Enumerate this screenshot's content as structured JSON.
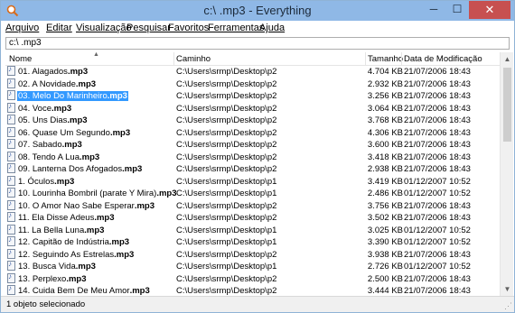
{
  "window": {
    "title": "c:\\ .mp3 - Everything",
    "min": "─",
    "max": "☐",
    "close": "✕"
  },
  "menu": [
    "Arquivo",
    "Editar",
    "Visualização",
    "Pesquisar",
    "Favoritos",
    "Ferramentas",
    "Ajuda"
  ],
  "search": {
    "value": "c:\\ .mp3"
  },
  "columns": {
    "name": "Nome",
    "path": "Caminho",
    "size": "Tamanho",
    "date": "Data de Modificação"
  },
  "rows": [
    {
      "name_pre": "01. Alagados",
      "name_ext": ".mp3",
      "path": "C:\\Users\\srmp\\Desktop\\p2",
      "size": "4.704 KB",
      "date": "21/07/2006 18:43"
    },
    {
      "name_pre": "02. A Novidade",
      "name_ext": ".mp3",
      "path": "C:\\Users\\srmp\\Desktop\\p2",
      "size": "2.932 KB",
      "date": "21/07/2006 18:43"
    },
    {
      "name_pre": "03. Melo Do Marinheiro",
      "name_ext": ".mp3",
      "path": "C:\\Users\\srmp\\Desktop\\p2",
      "size": "3.256 KB",
      "date": "21/07/2006 18:43",
      "selected": true
    },
    {
      "name_pre": "04. Voce",
      "name_ext": ".mp3",
      "path": "C:\\Users\\srmp\\Desktop\\p2",
      "size": "3.064 KB",
      "date": "21/07/2006 18:43"
    },
    {
      "name_pre": "05. Uns Dias",
      "name_ext": ".mp3",
      "path": "C:\\Users\\srmp\\Desktop\\p2",
      "size": "3.768 KB",
      "date": "21/07/2006 18:43"
    },
    {
      "name_pre": "06. Quase Um Segundo",
      "name_ext": ".mp3",
      "path": "C:\\Users\\srmp\\Desktop\\p2",
      "size": "4.306 KB",
      "date": "21/07/2006 18:43"
    },
    {
      "name_pre": "07. Sabado",
      "name_ext": ".mp3",
      "path": "C:\\Users\\srmp\\Desktop\\p2",
      "size": "3.600 KB",
      "date": "21/07/2006 18:43"
    },
    {
      "name_pre": "08. Tendo A Lua",
      "name_ext": ".mp3",
      "path": "C:\\Users\\srmp\\Desktop\\p2",
      "size": "3.418 KB",
      "date": "21/07/2006 18:43"
    },
    {
      "name_pre": "09. Lanterna Dos Afogados",
      "name_ext": ".mp3",
      "path": "C:\\Users\\srmp\\Desktop\\p2",
      "size": "2.938 KB",
      "date": "21/07/2006 18:43"
    },
    {
      "name_pre": "1. Óculos",
      "name_ext": ".mp3",
      "path": "C:\\Users\\srmp\\Desktop\\p1",
      "size": "3.419 KB",
      "date": "01/12/2007 10:52"
    },
    {
      "name_pre": "10. Lourinha Bombril (parate Y Mira)",
      "name_ext": ".mp3",
      "path": "C:\\Users\\srmp\\Desktop\\p1",
      "size": "2.486 KB",
      "date": "01/12/2007 10:52"
    },
    {
      "name_pre": "10. O Amor Nao Sabe Esperar",
      "name_ext": ".mp3",
      "path": "C:\\Users\\srmp\\Desktop\\p2",
      "size": "3.756 KB",
      "date": "21/07/2006 18:43"
    },
    {
      "name_pre": "11. Ela Disse Adeus",
      "name_ext": ".mp3",
      "path": "C:\\Users\\srmp\\Desktop\\p2",
      "size": "3.502 KB",
      "date": "21/07/2006 18:43"
    },
    {
      "name_pre": "11. La Bella Luna",
      "name_ext": ".mp3",
      "path": "C:\\Users\\srmp\\Desktop\\p1",
      "size": "3.025 KB",
      "date": "01/12/2007 10:52"
    },
    {
      "name_pre": "12. Capitão de Indústria",
      "name_ext": ".mp3",
      "path": "C:\\Users\\srmp\\Desktop\\p1",
      "size": "3.390 KB",
      "date": "01/12/2007 10:52"
    },
    {
      "name_pre": "12. Seguindo As Estrelas",
      "name_ext": ".mp3",
      "path": "C:\\Users\\srmp\\Desktop\\p2",
      "size": "3.938 KB",
      "date": "21/07/2006 18:43"
    },
    {
      "name_pre": "13. Busca Vida",
      "name_ext": ".mp3",
      "path": "C:\\Users\\srmp\\Desktop\\p1",
      "size": "2.726 KB",
      "date": "01/12/2007 10:52"
    },
    {
      "name_pre": "13. Perplexo",
      "name_ext": ".mp3",
      "path": "C:\\Users\\srmp\\Desktop\\p2",
      "size": "2.500 KB",
      "date": "21/07/2006 18:43"
    },
    {
      "name_pre": "14. Cuida Bem De Meu Amor",
      "name_ext": ".mp3",
      "path": "C:\\Users\\srmp\\Desktop\\p2",
      "size": "3.444 KB",
      "date": "21/07/2006 18:43"
    }
  ],
  "status": {
    "text": "1 objeto selecionado"
  }
}
